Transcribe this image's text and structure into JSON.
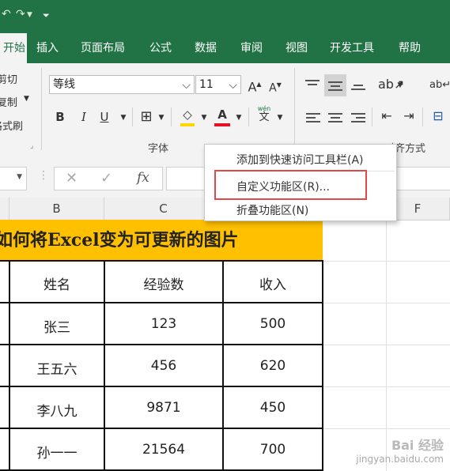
{
  "titlebar": {
    "undo_glyph": "↶",
    "redo_glyph": "↷",
    "dropdown_glyph": "▼",
    "qa_glyph": "⏷"
  },
  "tabs": [
    "开始",
    "插入",
    "页面布局",
    "公式",
    "数据",
    "审阅",
    "视图",
    "开发工具",
    "帮助"
  ],
  "clipboard": {
    "cut": "剪切",
    "copy": "复制",
    "format_painter": "格式刷"
  },
  "font": {
    "name": "等线",
    "size": "11",
    "group_label": "字体",
    "grow": "A",
    "shrink": "A",
    "bold": "B",
    "italic": "I",
    "underline": "U",
    "phonetic_top": "wén",
    "phonetic_bottom": "文",
    "font_color": "A"
  },
  "alignment": {
    "group_label": "对齐方式"
  },
  "formula": {
    "cancel": "✕",
    "enter": "✓",
    "fx": "fx"
  },
  "columns": [
    "B",
    "C",
    "F"
  ],
  "sheet": {
    "title": "如何将Excel变为可更新的图片",
    "headers": [
      "姓名",
      "经验数",
      "收入"
    ],
    "rows": [
      [
        "张三",
        "123",
        "500"
      ],
      [
        "王五六",
        "456",
        "620"
      ],
      [
        "李八九",
        "9871",
        "450"
      ],
      [
        "孙一一",
        "21564",
        "700"
      ]
    ]
  },
  "context_menu": {
    "items": [
      "添加到快速访问工具栏(A)",
      "自定义功能区(R)...",
      "折叠功能区(N)"
    ],
    "highlight_color": "#e0484a"
  },
  "watermark": {
    "line1": "Bai 经验",
    "line2": "jingyan.baidu.com"
  },
  "colors": {
    "excel_green": "#217346",
    "title_fill": "#ffc000",
    "underline_red": "#e81123",
    "fill_yellow": "#ffd700"
  }
}
